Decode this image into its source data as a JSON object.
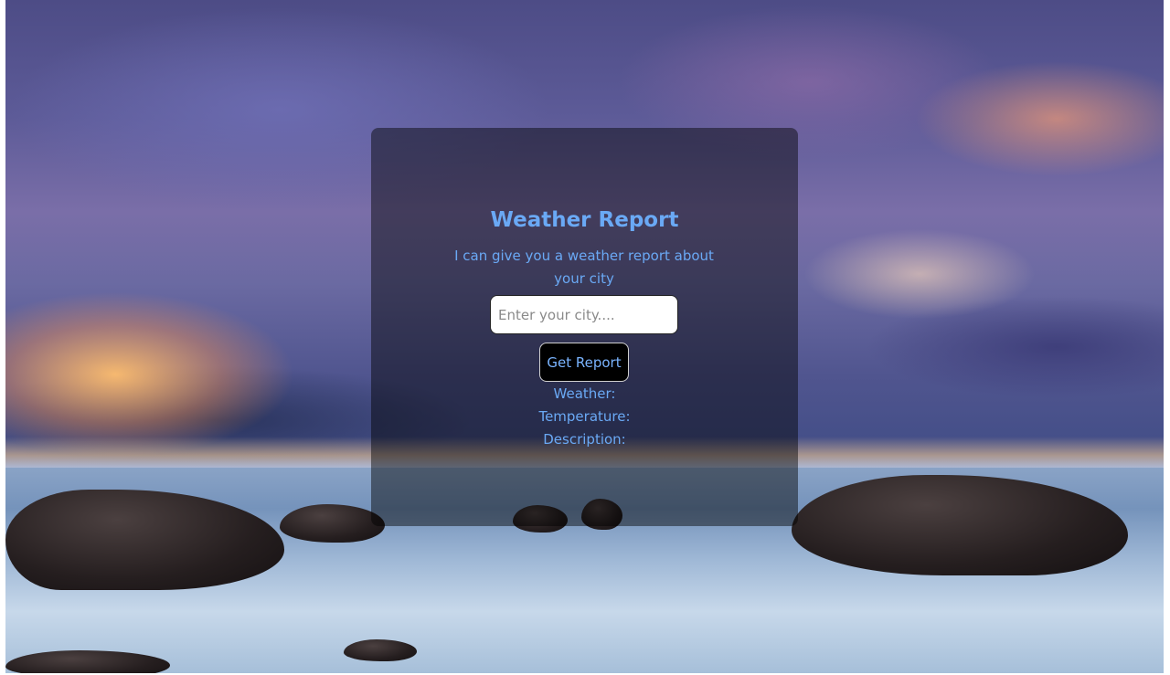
{
  "app": {
    "title": "Weather Report",
    "subtitle": "I can give you a weather report about your city"
  },
  "search": {
    "placeholder": "Enter your city....",
    "value": ""
  },
  "actions": {
    "get_report_label": "Get Report"
  },
  "results": {
    "weather_label": "Weather:",
    "temperature_label": "Temperature:",
    "description_label": "Description:"
  },
  "colors": {
    "accent_text": "#6aa9f5",
    "button_bg": "#000000",
    "button_text": "#7ab4ff",
    "card_overlay": "rgba(0,0,0,0.45)"
  },
  "background": {
    "image_subject": "seascape-sunset-clouds-rocks"
  }
}
